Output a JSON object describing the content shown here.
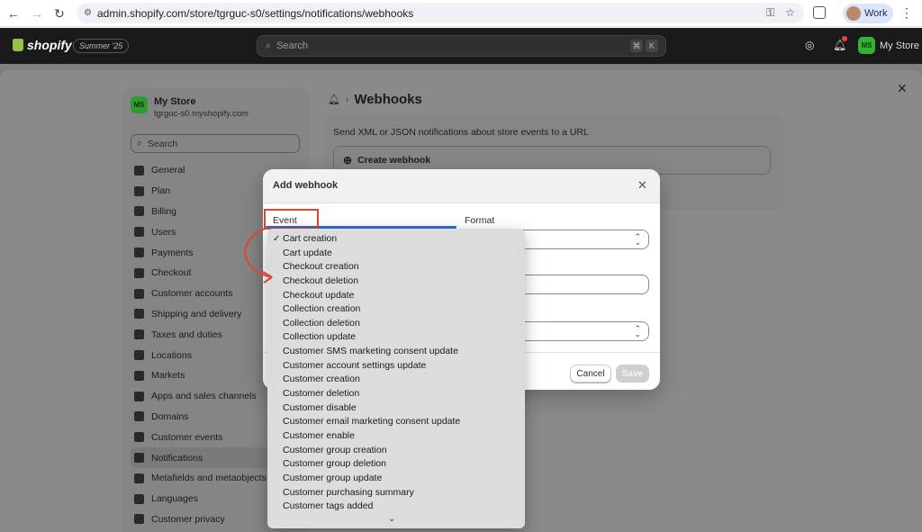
{
  "browser": {
    "url": "admin.shopify.com/store/tgrguc-s0/settings/notifications/webhooks",
    "profile_label": "Work"
  },
  "topbar": {
    "logo_text": "shopify",
    "edition_badge": "Summer '25",
    "search_placeholder": "Search",
    "shortcut_keys": [
      "⌘",
      "K"
    ],
    "store_label": "My Store",
    "store_initials": "MS"
  },
  "sidebar": {
    "store_initials": "MS",
    "store_name": "My Store",
    "store_url": "tgrguc-s0.myshopify.com",
    "search_placeholder": "Search",
    "items": [
      {
        "label": "General"
      },
      {
        "label": "Plan"
      },
      {
        "label": "Billing"
      },
      {
        "label": "Users"
      },
      {
        "label": "Payments"
      },
      {
        "label": "Checkout"
      },
      {
        "label": "Customer accounts"
      },
      {
        "label": "Shipping and delivery"
      },
      {
        "label": "Taxes and duties"
      },
      {
        "label": "Locations"
      },
      {
        "label": "Markets"
      },
      {
        "label": "Apps and sales channels"
      },
      {
        "label": "Domains"
      },
      {
        "label": "Customer events"
      },
      {
        "label": "Notifications"
      },
      {
        "label": "Metafields and metaobjects"
      },
      {
        "label": "Languages"
      },
      {
        "label": "Customer privacy"
      }
    ],
    "active_item": "Notifications"
  },
  "content": {
    "title": "Webhooks",
    "description": "Send XML or JSON notifications about store events to a URL",
    "create_label": "Create webhook"
  },
  "modal": {
    "title": "Add webhook",
    "event_label": "Event",
    "format_label": "Format",
    "cancel_label": "Cancel",
    "save_label": "Save"
  },
  "dropdown": {
    "selected": "Cart creation",
    "options": [
      "Cart creation",
      "Cart update",
      "Checkout creation",
      "Checkout deletion",
      "Checkout update",
      "Collection creation",
      "Collection deletion",
      "Collection update",
      "Customer SMS marketing consent update",
      "Customer account settings update",
      "Customer creation",
      "Customer deletion",
      "Customer disable",
      "Customer email marketing consent update",
      "Customer enable",
      "Customer group creation",
      "Customer group deletion",
      "Customer group update",
      "Customer purchasing summary",
      "Customer tags added"
    ]
  },
  "colors": {
    "highlight_box": "#e1452c",
    "annotation_arrow": "#e1452c",
    "focus_ring": "#2c6ecb",
    "store_avatar": "#34b233"
  }
}
